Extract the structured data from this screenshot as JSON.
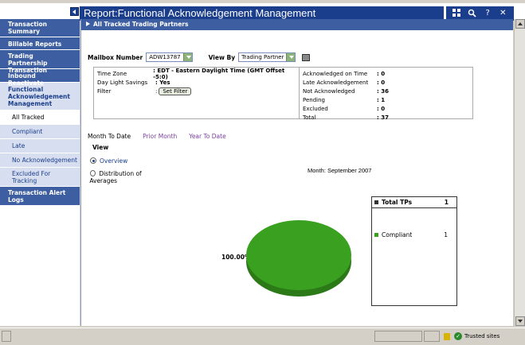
{
  "header": {
    "title": "Report:Functional Acknowledgement Management",
    "tools": [
      "grid-icon",
      "search-icon",
      "help-icon",
      "close-icon"
    ]
  },
  "sidebar": {
    "items": [
      {
        "label": "Transaction Summary"
      },
      {
        "label": "Billable Reports"
      },
      {
        "label": "Trading Partnership Transaction"
      },
      {
        "label": "Inbound Reactivate"
      },
      {
        "label": "Functional Acknowledgement Management"
      }
    ],
    "subitems": [
      "All Tracked",
      "Compliant",
      "Late",
      "No Acknowledgement",
      "Excluded For Tracking"
    ],
    "active_subitem": "All Tracked",
    "bottom_item": "Transaction Alert Logs"
  },
  "section": {
    "title": "All Tracked Trading Partners"
  },
  "filters": {
    "mailbox_label": "Mailbox Number",
    "mailbox_value": "ADW13787",
    "viewby_label": "View By",
    "viewby_value": "Trading Partner"
  },
  "info": {
    "timezone_label": "Time Zone",
    "timezone_value": ": EDT - Eastern Daylight Time (GMT Offset -5:0)",
    "dst_label": "Day Light Savings",
    "dst_value": ": Yes",
    "filter_label": "Filter",
    "filter_colon": ":",
    "set_filter_label": "Set Filter",
    "stats": [
      {
        "label": "Acknowledged on Time",
        "value": ": 0"
      },
      {
        "label": "Late Acknowledgement",
        "value": ": 0"
      },
      {
        "label": "Not Acknowledged",
        "value": ": 36"
      },
      {
        "label": "Pending",
        "value": ": 1"
      },
      {
        "label": "Excluded",
        "value": ": 0"
      },
      {
        "label": "Total",
        "value": ": 37"
      }
    ]
  },
  "period_tabs": [
    "Month To Date",
    "Prior Month",
    "Year To Date"
  ],
  "view": {
    "label": "View",
    "options": [
      "Overview",
      "Distribution of Averages"
    ],
    "selected": "Overview"
  },
  "chart_data": {
    "type": "pie",
    "title": "Month: September 2007",
    "slices": [
      {
        "name": "Compliant",
        "value": 1,
        "percent_label": "100.00%"
      }
    ],
    "legend": {
      "header_label": "Total TPs",
      "header_value": "1",
      "rows": [
        {
          "label": "Compliant",
          "value": "1"
        }
      ]
    },
    "colors": {
      "compliant": "#3aa120",
      "compliant_dark": "#2b7a17",
      "total": "#333333"
    }
  },
  "status": {
    "zone": "Trusted sites"
  }
}
